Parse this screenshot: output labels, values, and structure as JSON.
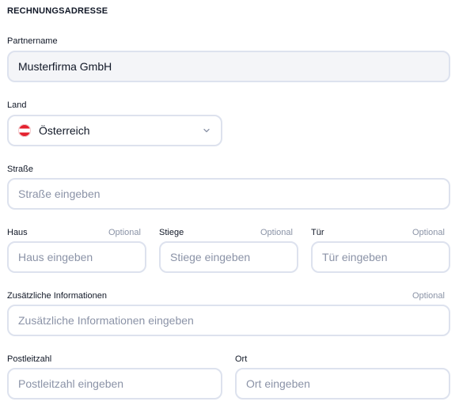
{
  "section_title": "RECHNUNGSADRESSE",
  "partnername": {
    "label": "Partnername",
    "value": "Musterfirma GmbH"
  },
  "land": {
    "label": "Land",
    "value": "Österreich",
    "flag_icon": "austria-flag-icon"
  },
  "strasse": {
    "label": "Straße",
    "placeholder": "Straße eingeben"
  },
  "haus": {
    "label": "Haus",
    "optional": "Optional",
    "placeholder": "Haus eingeben"
  },
  "stiege": {
    "label": "Stiege",
    "optional": "Optional",
    "placeholder": "Stiege eingeben"
  },
  "tuer": {
    "label": "Tür",
    "optional": "Optional",
    "placeholder": "Tür eingeben"
  },
  "zusatz": {
    "label": "Zusätzliche Informationen",
    "optional": "Optional",
    "placeholder": "Zusätzliche Informationen eingeben"
  },
  "plz": {
    "label": "Postleitzahl",
    "placeholder": "Postleitzahl eingeben"
  },
  "ort": {
    "label": "Ort",
    "placeholder": "Ort eingeben"
  },
  "colors": {
    "border": "#dde2ee",
    "placeholder": "#8b93a7",
    "optional": "#8a93a6",
    "filled_bg": "#f4f5f8"
  }
}
